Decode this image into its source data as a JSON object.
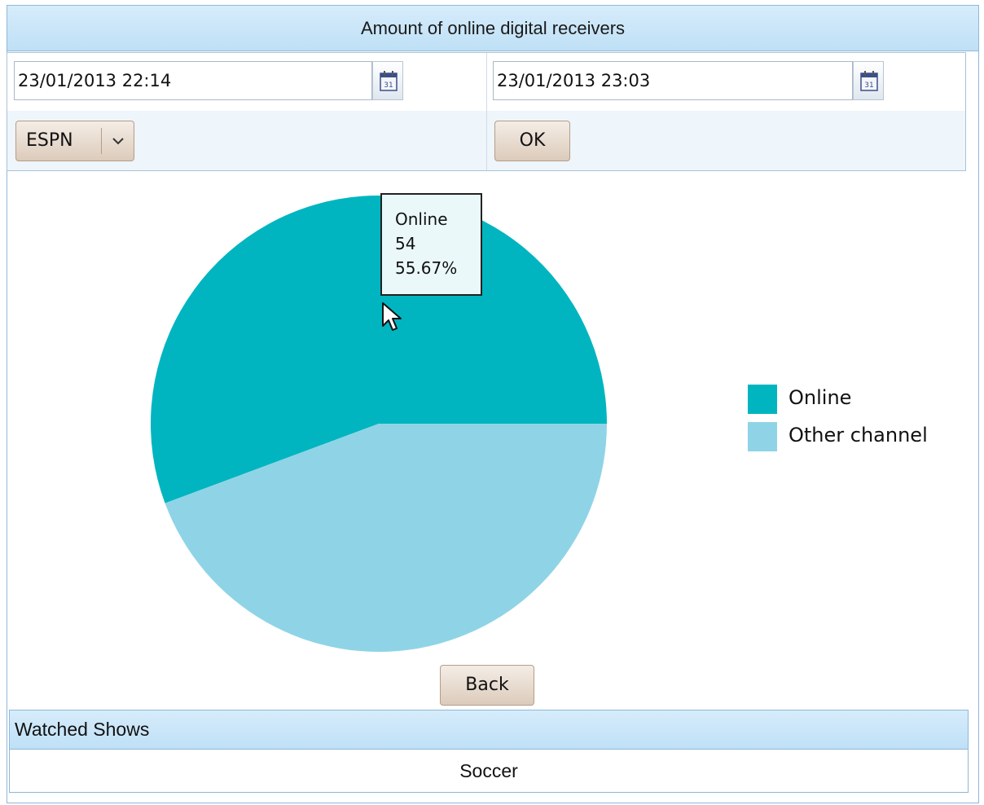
{
  "panel": {
    "title": "Amount of online digital receivers"
  },
  "filters": {
    "start_date": "23/01/2013 22:14",
    "end_date": "23/01/2013 23:03",
    "channel": "ESPN",
    "ok_label": "OK",
    "calendar_icon": "calendar-icon"
  },
  "tooltip": {
    "label": "Online",
    "value": "54",
    "percent": "55.67%"
  },
  "chart_data": {
    "type": "pie",
    "slices": [
      {
        "label": "Online",
        "value": 54,
        "percent": 55.67,
        "color": "#00b5c0"
      },
      {
        "label": "Other channel",
        "value": 43,
        "percent": 44.33,
        "color": "#8fd4e6"
      }
    ],
    "legend_position": "right"
  },
  "back_label": "Back",
  "shows": {
    "header": "Watched Shows",
    "rows": [
      "Soccer"
    ]
  }
}
